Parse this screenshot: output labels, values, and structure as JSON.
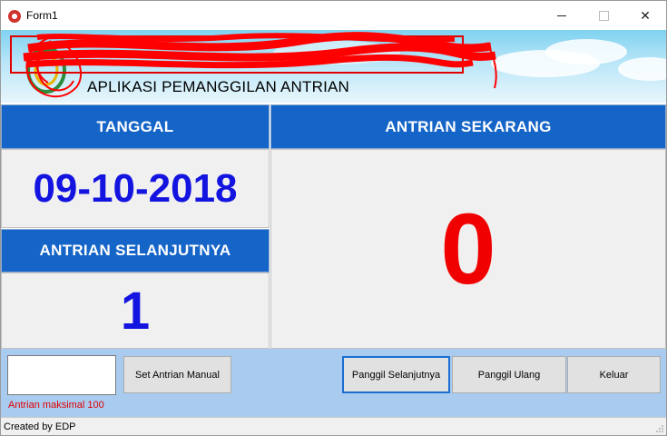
{
  "window": {
    "title": "Form1",
    "minimize_label": "—",
    "maximize_label": "□",
    "close_label": "✕"
  },
  "banner": {
    "app_title": "APLIKASI PEMANGGILAN ANTRIAN"
  },
  "date_panel": {
    "header": "TANGGAL",
    "value": "09-10-2018"
  },
  "next_panel": {
    "header": "ANTRIAN SELANJUTNYA",
    "value": "1"
  },
  "current_panel": {
    "header": "ANTRIAN SEKARANG",
    "value": "0"
  },
  "controls": {
    "manual_input_value": "",
    "set_manual_label": "Set Antrian Manual",
    "call_next_label": "Panggil Selanjutnya",
    "call_again_label": "Panggil Ulang",
    "exit_label": "Keluar",
    "max_hint": "Antrian maksimal 100"
  },
  "status": {
    "text": "Created by EDP"
  },
  "colors": {
    "header_blue": "#1565c8",
    "value_blue": "#1414e0",
    "value_red": "#f00000",
    "controls_bg": "#a9cbf0"
  },
  "icons": {
    "app": "app-icon",
    "logo": "logo-icon",
    "grip": "resize-grip-icon"
  }
}
